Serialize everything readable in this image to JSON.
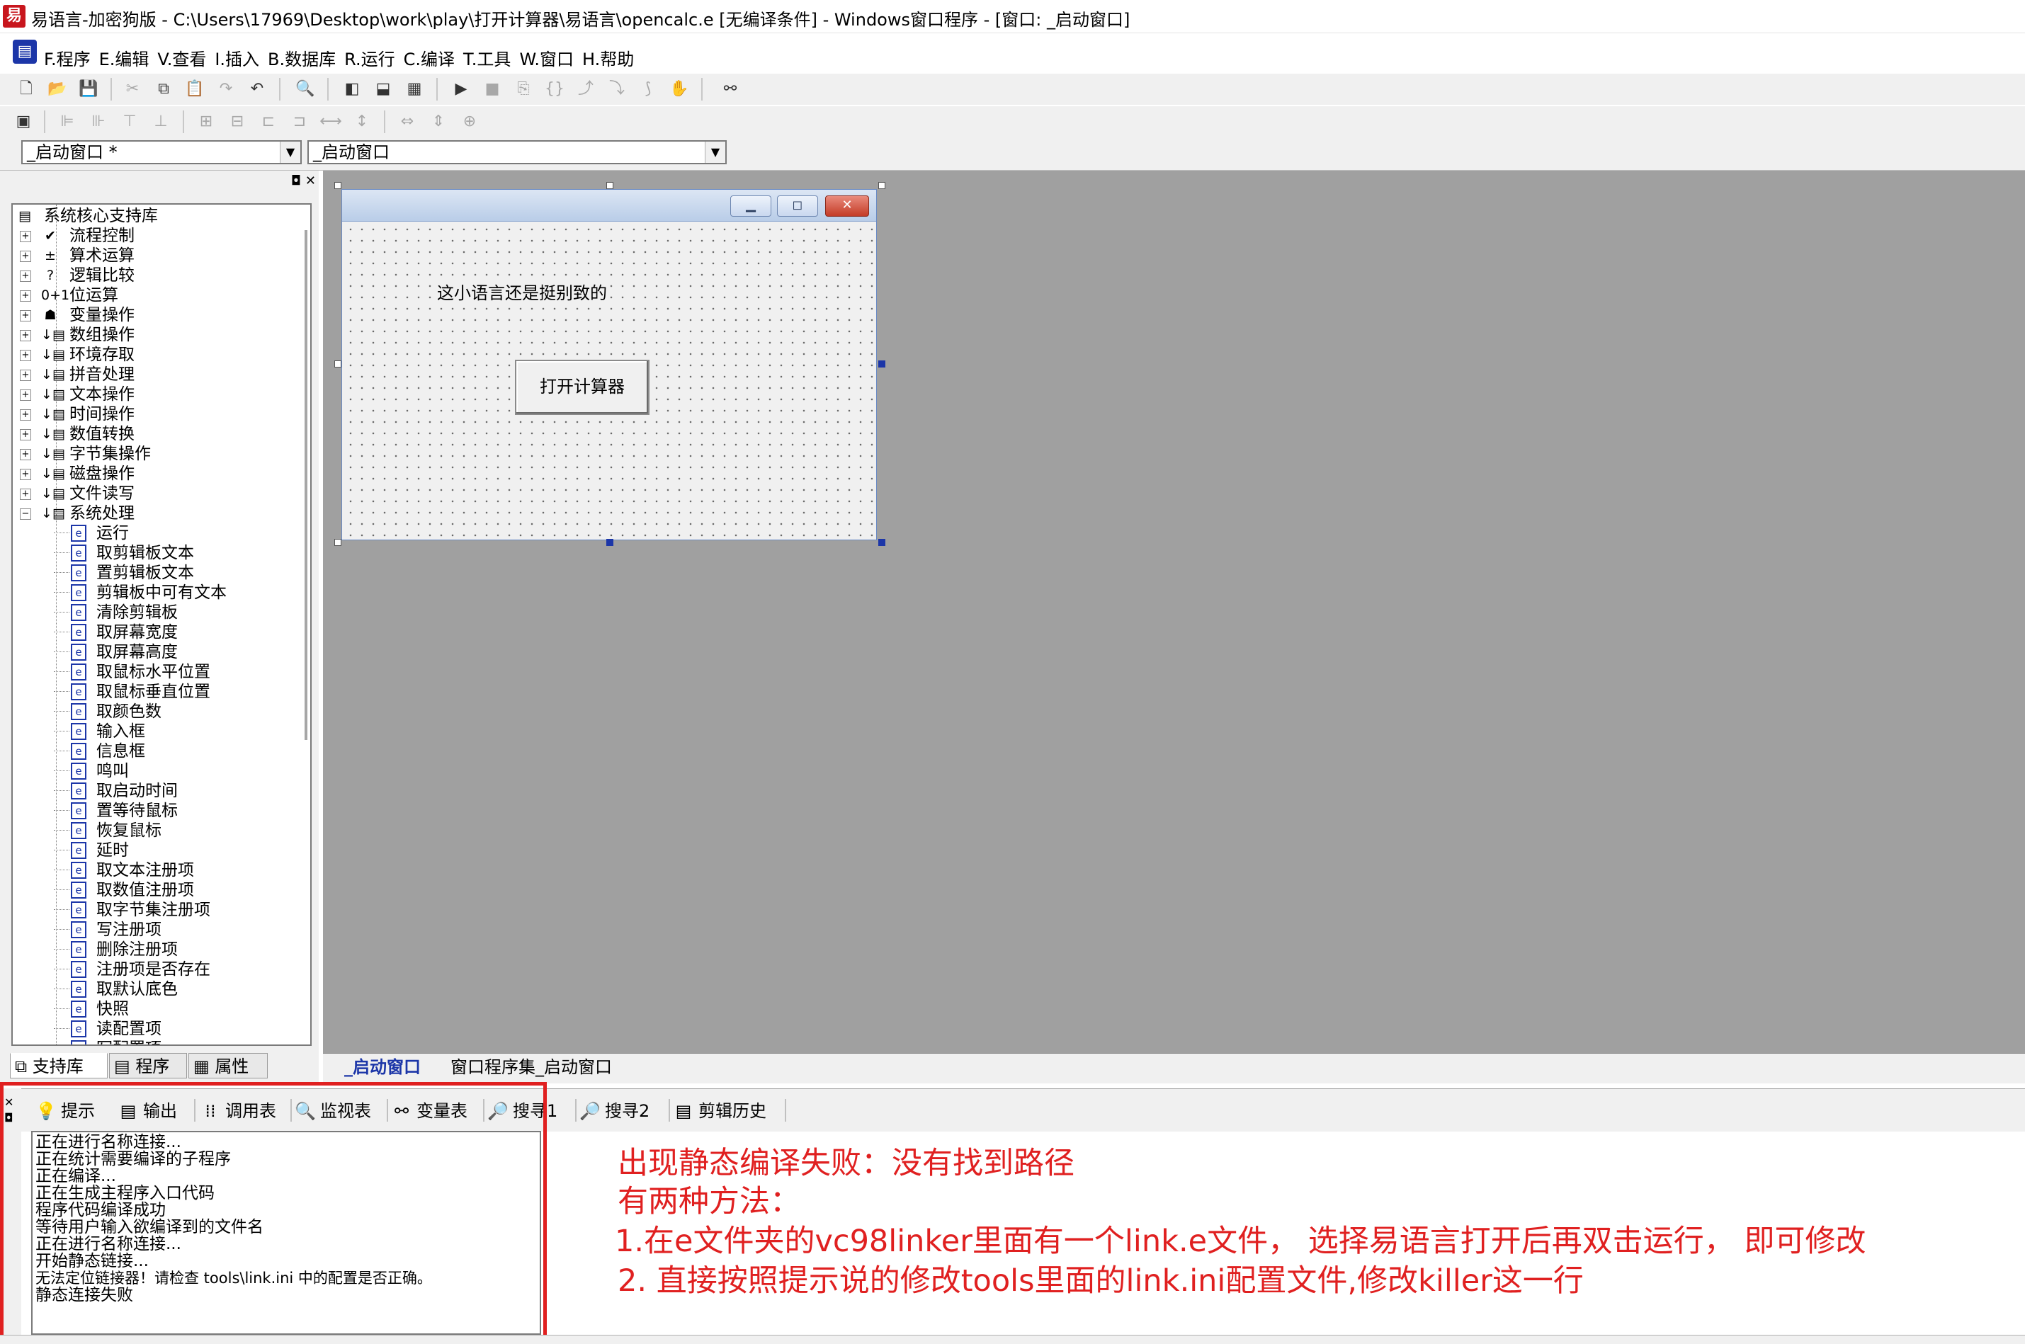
{
  "window": {
    "title": "易语言-加密狗版 - C:\\Users\\17969\\Desktop\\work\\play\\打开计算器\\易语言\\opencalc.e [无编译条件] - Windows窗口程序 - [窗口: _启动窗口]"
  },
  "menu": {
    "items": [
      "F.程序",
      "E.编辑",
      "V.查看",
      "I.插入",
      "B.数据库",
      "R.运行",
      "C.编译",
      "T.工具",
      "W.窗口",
      "H.帮助"
    ]
  },
  "combos": {
    "left": "_启动窗口 *",
    "right": "_启动窗口"
  },
  "tree": {
    "root": "系统核心支持库",
    "categories": [
      "流程控制",
      "算术运算",
      "逻辑比较",
      "位运算",
      "变量操作",
      "数组操作",
      "环境存取",
      "拼音处理",
      "文本操作",
      "时间操作",
      "数值转换",
      "字节集操作",
      "磁盘操作",
      "文件读写",
      "系统处理"
    ],
    "category_icons": [
      "✔",
      "±",
      "?",
      "0+1",
      "☗",
      "↓▤",
      "↓▤",
      "↓▤",
      "↓▤",
      "↓▤",
      "↓▤",
      "↓▤",
      "↓▤",
      "↓▤",
      "↓▤"
    ],
    "expanded": "系统处理",
    "commands": [
      "运行",
      "取剪辑板文本",
      "置剪辑板文本",
      "剪辑板中可有文本",
      "清除剪辑板",
      "取屏幕宽度",
      "取屏幕高度",
      "取鼠标水平位置",
      "取鼠标垂直位置",
      "取颜色数",
      "输入框",
      "信息框",
      "鸣叫",
      "取启动时间",
      "置等待鼠标",
      "恢复鼠标",
      "延时",
      "取文本注册项",
      "取数值注册项",
      "取字节集注册项",
      "写注册项",
      "删除注册项",
      "注册项是否存在",
      "取默认底色",
      "快照",
      "读配置项",
      "写配置项"
    ]
  },
  "left_tabs": {
    "support": "支持库",
    "program": "程序",
    "props": "属性"
  },
  "form": {
    "label_text": "这小语言还是挺别致的",
    "button_text": "打开计算器"
  },
  "designer_tabs": {
    "start_window": "_启动窗口",
    "program_set": "窗口程序集_启动窗口"
  },
  "output_tabs": {
    "hint": "提示",
    "output": "输出",
    "calls": "调用表",
    "watch": "监视表",
    "vars": "变量表",
    "find1": "搜寻1",
    "find2": "搜寻2",
    "clip": "剪辑历史"
  },
  "output_lines": [
    "正在进行名称连接...",
    "正在统计需要编译的子程序",
    "正在编译...",
    "正在生成主程序入口代码",
    "程序代码编译成功",
    "等待用户输入欲编译到的文件名",
    "正在进行名称连接...",
    "开始静态链接...",
    "无法定位链接器！请检查 tools\\link.ini 中的配置是否正确。",
    "静态连接失败"
  ],
  "annotation": {
    "line1": "出现静态编译失败：没有找到路径",
    "line2": "有两种方法：",
    "line3": "1.在e文件夹的vc98linker里面有一个link.e文件， 选择易语言打开后再双击运行， 即可修改",
    "line4": "2. 直接按照提示说的修改tools里面的link.ini配置文件,修改killer这一行",
    "color": "#e02020"
  }
}
